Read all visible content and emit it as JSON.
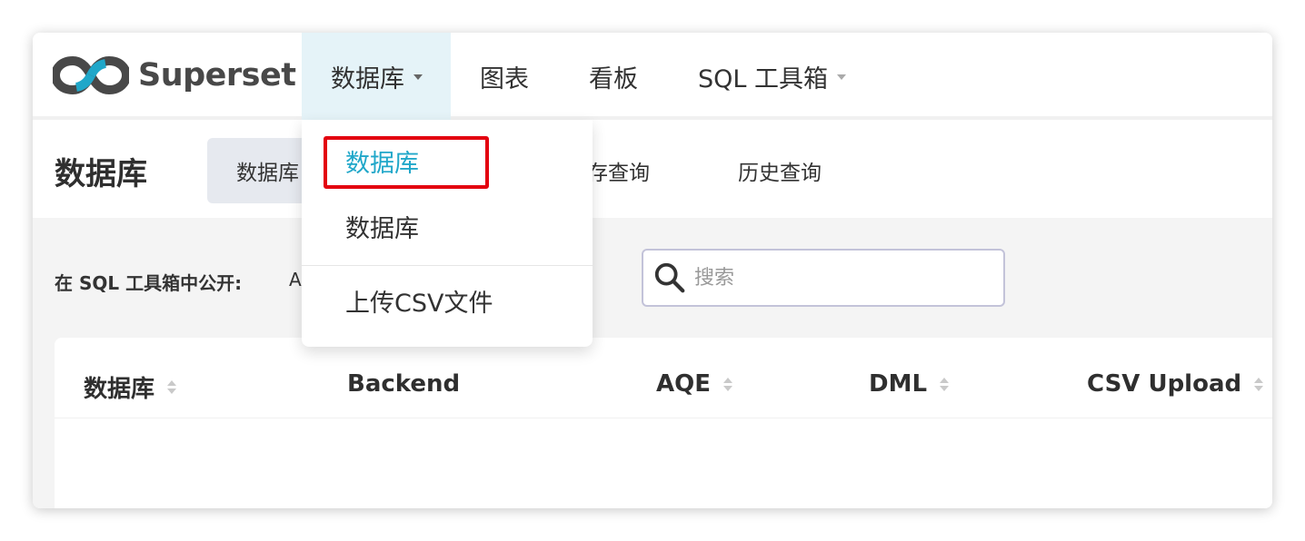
{
  "app": {
    "name": "Superset"
  },
  "navbar": {
    "items": [
      {
        "label": "数据库",
        "has_caret": true
      },
      {
        "label": "图表",
        "has_caret": false
      },
      {
        "label": "看板",
        "has_caret": false
      },
      {
        "label": "SQL 工具箱",
        "has_caret": true
      }
    ]
  },
  "dropdown": {
    "items": [
      {
        "label": "数据库",
        "selected": true
      },
      {
        "label": "数据库",
        "selected": false
      },
      {
        "label": "上传CSV文件",
        "selected": false
      }
    ]
  },
  "subheader": {
    "title": "数据库",
    "tabs": [
      {
        "label": "数据库",
        "active": true
      },
      {
        "label": "存查询",
        "active": false
      },
      {
        "label": "历史查询",
        "active": false
      }
    ]
  },
  "filters": {
    "expose_label": "在 SQL 工具箱中公开:",
    "expose_value": "A",
    "search_placeholder": "搜索"
  },
  "table": {
    "columns": [
      {
        "label": "数据库",
        "sortable": true
      },
      {
        "label": "Backend",
        "sortable": false
      },
      {
        "label": "AQE",
        "sortable": true
      },
      {
        "label": "DML",
        "sortable": true
      },
      {
        "label": "CSV Upload",
        "sortable": true
      }
    ]
  },
  "colors": {
    "accent": "#20a7c9",
    "nav_active_bg": "#e5f3f8",
    "highlight": "#e3000f",
    "content_bg": "#f4f4f4"
  },
  "icons": {
    "logo": "superset-infinity-logo",
    "search": "search-icon",
    "caret": "caret-down-icon",
    "sort": "sort-icon"
  }
}
